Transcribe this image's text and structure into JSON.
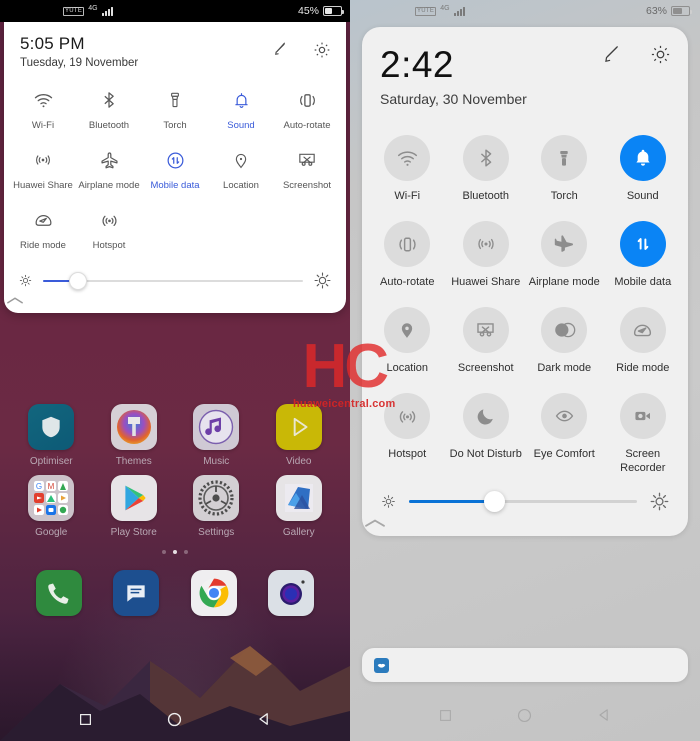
{
  "watermark": {
    "logo": "HC",
    "url": "huaweicentral.com"
  },
  "left_phone": {
    "status_bar": {
      "carrier": "YUTE",
      "network_type": "4G",
      "battery_percent": "45%",
      "signal_icon": "signal-bars-icon",
      "battery_icon": "battery-icon"
    },
    "panel": {
      "time": "5:05 PM",
      "date": "Tuesday, 19 November",
      "edit_icon": "edit-pencil-icon",
      "settings_icon": "gear-icon",
      "tiles": [
        {
          "label": "Wi-Fi",
          "icon": "wifi-icon",
          "active": false
        },
        {
          "label": "Bluetooth",
          "icon": "bluetooth-icon",
          "active": false
        },
        {
          "label": "Torch",
          "icon": "torch-icon",
          "active": false
        },
        {
          "label": "Sound",
          "icon": "bell-icon",
          "active": true
        },
        {
          "label": "Auto-rotate",
          "icon": "auto-rotate-icon",
          "active": false
        },
        {
          "label": "Huawei Share",
          "icon": "huawei-share-icon",
          "active": false
        },
        {
          "label": "Airplane mode",
          "icon": "airplane-icon",
          "active": false
        },
        {
          "label": "Mobile data",
          "icon": "mobile-data-icon",
          "active": true
        },
        {
          "label": "Location",
          "icon": "location-pin-icon",
          "active": false
        },
        {
          "label": "Screenshot",
          "icon": "screenshot-icon",
          "active": false
        },
        {
          "label": "Ride mode",
          "icon": "ride-mode-icon",
          "active": false
        },
        {
          "label": "Hotspot",
          "icon": "hotspot-icon",
          "active": false
        }
      ],
      "brightness": {
        "low_icon": "brightness-low-icon",
        "high_icon": "brightness-high-icon",
        "value_percent": 12
      },
      "collapse_icon": "chevron-up-icon"
    },
    "home_screen": {
      "rows": [
        [
          {
            "label": "Optimiser",
            "icon": "optimiser-icon"
          },
          {
            "label": "Themes",
            "icon": "themes-icon"
          },
          {
            "label": "Music",
            "icon": "music-icon"
          },
          {
            "label": "Video",
            "icon": "video-icon"
          }
        ],
        [
          {
            "label": "Google",
            "icon": "google-folder-icon"
          },
          {
            "label": "Play Store",
            "icon": "play-store-icon"
          },
          {
            "label": "Settings",
            "icon": "settings-icon"
          },
          {
            "label": "Gallery",
            "icon": "gallery-icon"
          }
        ]
      ],
      "page_indicator": {
        "pages": 3,
        "active": 2
      },
      "dock": [
        {
          "label": "Phone",
          "icon": "phone-icon"
        },
        {
          "label": "Messages",
          "icon": "messages-icon"
        },
        {
          "label": "Chrome",
          "icon": "chrome-icon"
        },
        {
          "label": "Camera",
          "icon": "camera-icon"
        }
      ]
    },
    "nav_bar": {
      "recents": "recents-square-icon",
      "home": "home-circle-icon",
      "back": "back-triangle-icon"
    }
  },
  "right_phone": {
    "status_bar": {
      "carrier": "YUTE",
      "network_type": "4G",
      "battery_percent": "63%",
      "signal_icon": "signal-bars-icon",
      "battery_icon": "battery-icon"
    },
    "panel": {
      "time": "2:42",
      "date": "Saturday, 30 November",
      "edit_icon": "edit-pencil-icon",
      "settings_icon": "gear-icon",
      "active_color": "#0a84f5",
      "tiles": [
        {
          "label": "Wi-Fi",
          "icon": "wifi-icon",
          "active": false
        },
        {
          "label": "Bluetooth",
          "icon": "bluetooth-icon",
          "active": false
        },
        {
          "label": "Torch",
          "icon": "torch-icon",
          "active": false
        },
        {
          "label": "Sound",
          "icon": "bell-icon",
          "active": true
        },
        {
          "label": "Auto-rotate",
          "icon": "auto-rotate-icon",
          "active": false
        },
        {
          "label": "Huawei Share",
          "icon": "huawei-share-icon",
          "active": false
        },
        {
          "label": "Airplane mode",
          "icon": "airplane-icon",
          "active": false
        },
        {
          "label": "Mobile data",
          "icon": "mobile-data-icon",
          "active": true
        },
        {
          "label": "Location",
          "icon": "location-pin-icon",
          "active": false
        },
        {
          "label": "Screenshot",
          "icon": "screenshot-icon",
          "active": false
        },
        {
          "label": "Dark mode",
          "icon": "dark-mode-icon",
          "active": false
        },
        {
          "label": "Ride mode",
          "icon": "ride-mode-icon",
          "active": false
        },
        {
          "label": "Hotspot",
          "icon": "hotspot-icon",
          "active": false
        },
        {
          "label": "Do Not Disturb",
          "icon": "moon-icon",
          "active": false
        },
        {
          "label": "Eye Comfort",
          "icon": "eye-icon",
          "active": false
        },
        {
          "label": "Screen Recorder",
          "icon": "screen-recorder-icon",
          "active": false
        }
      ],
      "brightness": {
        "low_icon": "brightness-low-icon",
        "high_icon": "brightness-high-icon",
        "value_percent": 37
      },
      "collapse_icon": "chevron-up-icon"
    },
    "notification": {
      "app_icon": "notification-app-icon"
    },
    "nav_bar": {
      "recents": "recents-square-icon",
      "home": "home-circle-icon",
      "back": "back-triangle-icon"
    }
  }
}
